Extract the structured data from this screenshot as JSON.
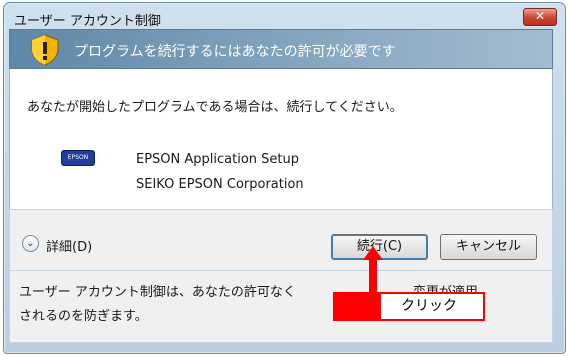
{
  "window": {
    "title": "ユーザー アカウント制御",
    "close_label": "✕"
  },
  "banner": {
    "text": "プログラムを続行するにはあなたの許可が必要です",
    "icon": "shield-warning-icon"
  },
  "content": {
    "message": "あなたが開始したプログラムである場合は、続行してください。",
    "app_icon_text": "EPSON",
    "app_name": "EPSON Application Setup",
    "publisher": "SEIKO EPSON Corporation"
  },
  "buttons": {
    "details_label": "詳細(D)",
    "continue_label": "続行(C)",
    "cancel_label": "キャンセル"
  },
  "footer": {
    "text": "ユーザー アカウント制御は、あなたの許可なく　　　　　　　　　変更が適用\nされるのを防ぎます。"
  },
  "annotation": {
    "callout_text": "クリック",
    "color": "#ff0000"
  }
}
